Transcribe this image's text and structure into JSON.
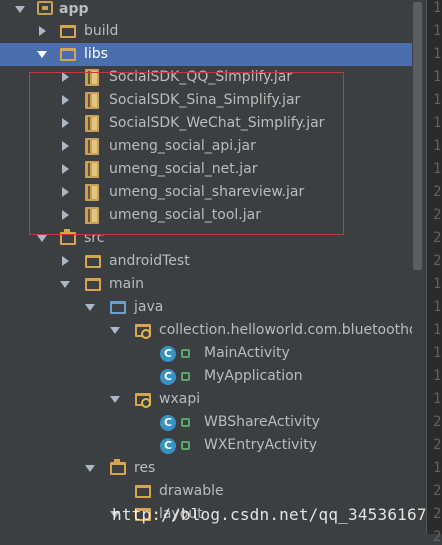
{
  "tree": [
    {
      "label": "app",
      "kind": "app",
      "arrow": "expanded",
      "bold": true
    },
    {
      "label": "build",
      "kind": "folder",
      "arrow": "collapsed"
    },
    {
      "label": "libs",
      "kind": "folder",
      "arrow": "expanded",
      "selected": true
    },
    {
      "label": "SocialSDK_QQ_Simplify.jar",
      "kind": "jar",
      "arrow": "collapsed"
    },
    {
      "label": "SocialSDK_Sina_Simplify.jar",
      "kind": "jar",
      "arrow": "collapsed"
    },
    {
      "label": "SocialSDK_WeChat_Simplify.jar",
      "kind": "jar",
      "arrow": "collapsed"
    },
    {
      "label": "umeng_social_api.jar",
      "kind": "jar",
      "arrow": "collapsed"
    },
    {
      "label": "umeng_social_net.jar",
      "kind": "jar",
      "arrow": "collapsed"
    },
    {
      "label": "umeng_social_shareview.jar",
      "kind": "jar",
      "arrow": "collapsed"
    },
    {
      "label": "umeng_social_tool.jar",
      "kind": "jar",
      "arrow": "collapsed"
    },
    {
      "label": "src",
      "kind": "folder-src",
      "arrow": "expanded"
    },
    {
      "label": "androidTest",
      "kind": "folder",
      "arrow": "collapsed"
    },
    {
      "label": "main",
      "kind": "folder",
      "arrow": "expanded"
    },
    {
      "label": "java",
      "kind": "folder-blue",
      "arrow": "expanded"
    },
    {
      "label": "collection.helloworld.com.bluetoothder",
      "kind": "package",
      "arrow": "expanded"
    },
    {
      "label": "MainActivity",
      "kind": "class",
      "arrow": "none"
    },
    {
      "label": "MyApplication",
      "kind": "class",
      "arrow": "none"
    },
    {
      "label": "wxapi",
      "kind": "package",
      "arrow": "expanded"
    },
    {
      "label": "WBShareActivity",
      "kind": "class",
      "arrow": "none"
    },
    {
      "label": "WXEntryActivity",
      "kind": "class",
      "arrow": "none"
    },
    {
      "label": "res",
      "kind": "folder-res",
      "arrow": "expanded"
    },
    {
      "label": "drawable",
      "kind": "folder",
      "arrow": "none"
    },
    {
      "label": "layout",
      "kind": "folder",
      "arrow": "expanded"
    },
    {
      "label": "",
      "kind": "file",
      "arrow": "none"
    }
  ],
  "gutter_numbers": [
    "1",
    "1",
    "1",
    "1",
    "1",
    "1",
    "1",
    "1",
    "2",
    "2",
    "2",
    "2",
    "1",
    "1",
    "1",
    "1",
    "1",
    "1",
    "2",
    "2",
    "1",
    "2",
    "2",
    "2"
  ],
  "watermark": "http://blog.csdn.net/qq_34536167",
  "colors": {
    "selection": "#4b6eaf",
    "highlight_box": "#c23b3b",
    "background": "#3c3f41"
  }
}
